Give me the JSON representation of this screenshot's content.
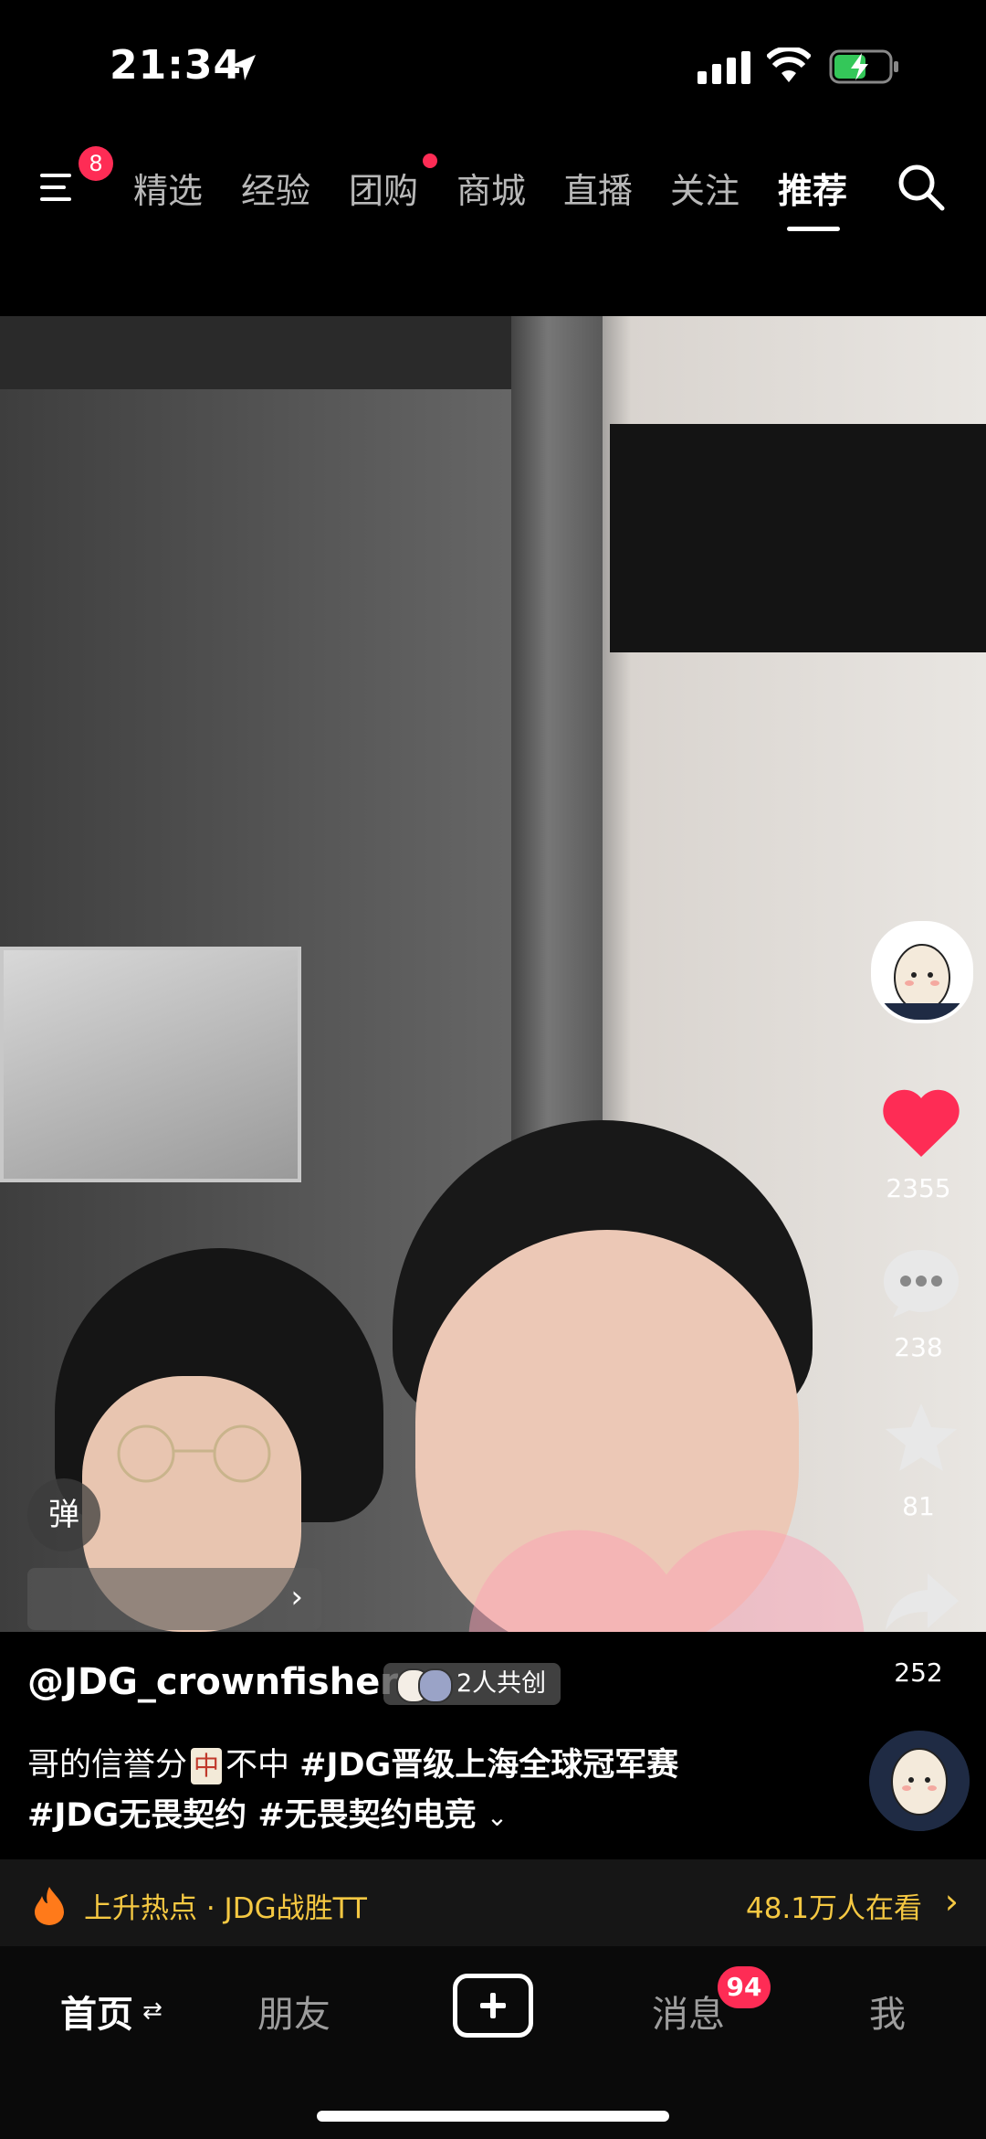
{
  "status_bar": {
    "time": "21:34"
  },
  "top_nav": {
    "menu_badge": "8",
    "tabs": [
      {
        "label": "精选"
      },
      {
        "label": "经验"
      },
      {
        "label": "团购"
      },
      {
        "label": "商城"
      },
      {
        "label": "直播"
      },
      {
        "label": "关注"
      },
      {
        "label": "推荐"
      }
    ],
    "active_tab": "推荐"
  },
  "video": {
    "danmu_button": "弹"
  },
  "actions": {
    "likes": "2355",
    "comments": "238",
    "favorites": "81",
    "shares": "252"
  },
  "caption": {
    "author": "@JDG_crownfisher",
    "cocreate": "2人共创",
    "line1_prefix": "哥的信誉分",
    "chip": "中",
    "line1_suffix": "不中 ",
    "line1_tag": "#JDG晋级上海全球冠军赛",
    "line2": "#JDG无畏契约 #无畏契约电竞"
  },
  "hot_bar": {
    "left": "上升热点 · JDG战胜TT",
    "right": "48.1万人在看"
  },
  "bottom_nav": {
    "home": "首页",
    "friends": "朋友",
    "messages": "消息",
    "messages_badge": "94",
    "me": "我"
  },
  "colors": {
    "accent_red": "#fe2c55",
    "hot_yellow": "#f5c842"
  }
}
